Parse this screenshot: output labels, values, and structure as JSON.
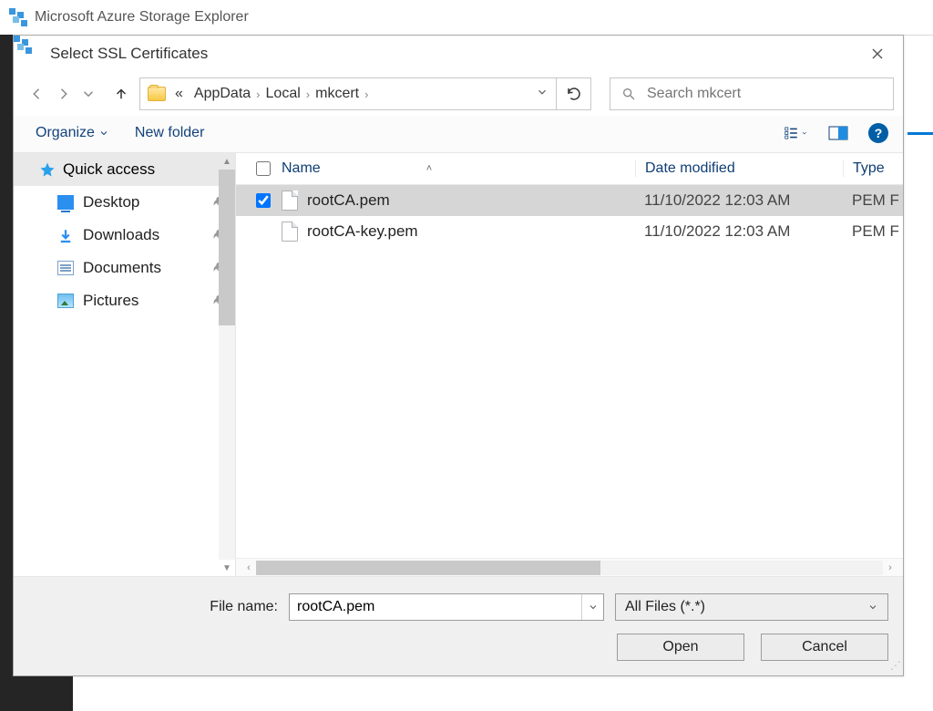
{
  "app": {
    "title": "Microsoft Azure Storage Explorer"
  },
  "dialog": {
    "title": "Select SSL Certificates",
    "breadcrumb": {
      "prefix": "«",
      "parts": [
        "AppData",
        "Local",
        "mkcert"
      ]
    },
    "search": {
      "placeholder": "Search mkcert"
    },
    "toolbar": {
      "organize": "Organize",
      "newFolder": "New folder"
    },
    "columns": {
      "name": "Name",
      "date": "Date modified",
      "type": "Type"
    },
    "sidebar": {
      "quickAccess": "Quick access",
      "items": [
        {
          "label": "Desktop",
          "icon": "desktop",
          "pinned": true
        },
        {
          "label": "Downloads",
          "icon": "download",
          "pinned": true
        },
        {
          "label": "Documents",
          "icon": "docs",
          "pinned": true
        },
        {
          "label": "Pictures",
          "icon": "pics",
          "pinned": true
        }
      ]
    },
    "files": [
      {
        "name": "rootCA.pem",
        "date": "11/10/2022 12:03 AM",
        "type": "PEM F",
        "selected": true,
        "checked": true
      },
      {
        "name": "rootCA-key.pem",
        "date": "11/10/2022 12:03 AM",
        "type": "PEM F",
        "selected": false,
        "checked": false
      }
    ],
    "footer": {
      "fileNameLabel": "File name:",
      "fileNameValue": "rootCA.pem",
      "filterLabel": "All Files (*.*)",
      "open": "Open",
      "cancel": "Cancel"
    }
  }
}
